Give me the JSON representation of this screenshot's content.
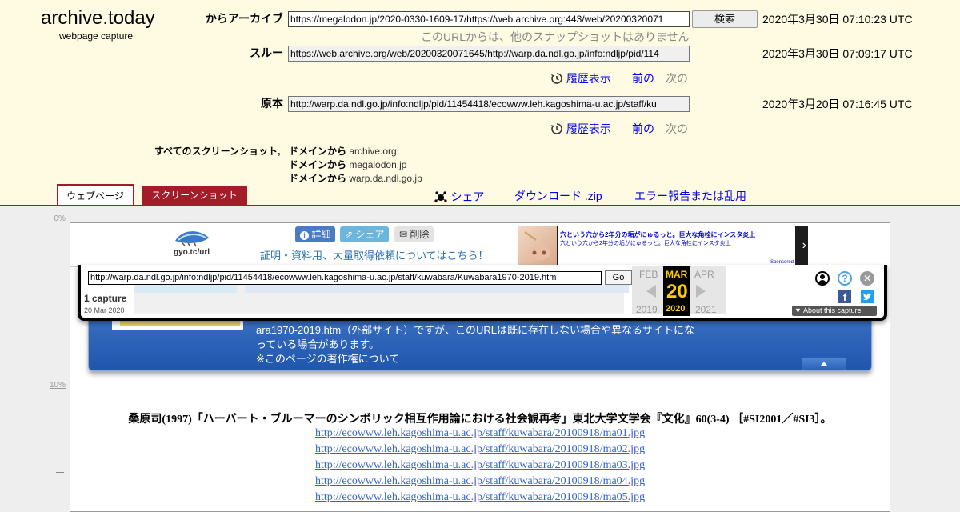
{
  "site": {
    "title": "archive.today",
    "subtitle": "webpage capture"
  },
  "rows": {
    "from": {
      "label": "からアーカイブ",
      "url": "https://megalodon.jp/2020-0330-1609-17/https://web.archive.org:443/web/20200320071",
      "timestamp": "2020年3月30日 07:10:23 UTC",
      "note": "このURLからは、他のスナップショットはありません"
    },
    "through": {
      "label": "スルー",
      "url": "https://web.archive.org/web/20200320071645/http://warp.da.ndl.go.jp/info:ndljp/pid/114",
      "timestamp": "2020年3月30日 07:09:17 UTC"
    },
    "original": {
      "label": "原本",
      "url": "http://warp.da.ndl.go.jp/info:ndljp/pid/11454418/ecowww.leh.kagoshima-u.ac.jp/staff/ku",
      "timestamp": "2020年3月20日 07:16:45 UTC"
    }
  },
  "search_button": "検索",
  "history_label": "履歴表示",
  "prev_label": "前の",
  "next_label": "次の",
  "all_screenshots_label": "すべてのスクリーンショット,",
  "from_domain_label": "ドメインから",
  "domains": [
    "archive.org",
    "megalodon.jp",
    "warp.da.ndl.go.jp"
  ],
  "tabs": {
    "webpage": "ウェブページ",
    "screenshot": "スクリーンショット"
  },
  "header_links": {
    "share": "シェア",
    "download": "ダウンロード .zip",
    "report": "エラー報告または乱用"
  },
  "ruler": {
    "top": "0%",
    "mid": "10%"
  },
  "megalodon": {
    "logo_text": "gyo.tc/url",
    "btn_detail": "詳細",
    "btn_share": "シェア",
    "btn_delete": "削除",
    "notice": "証明・資料用、大量取得依頼についてはこちら！",
    "ad_line1": "穴という穴から2年分の垢がにゅるっと。巨大な角栓にインスタ炎上",
    "ad_line2": "穴という穴から2年分の垢がにゅるっと。巨大な角栓にインスタ炎上",
    "ad_sponsored": "Sponsored"
  },
  "wayback": {
    "url": "http://warp.da.ndl.go.jp/info:ndljp/pid/11454418/ecowww.leh.kagoshima-u.ac.jp/staff/kuwabara/Kuwabara1970-2019.htm",
    "go": "Go",
    "captures": "1 capture",
    "capture_date": "20 Mar 2020",
    "prev_month": "FEB",
    "cur_month": "MAR",
    "next_month": "APR",
    "day": "20",
    "prev_year": "2019",
    "cur_year": "2020",
    "next_year": "2021",
    "about": "About this capture"
  },
  "panel": {
    "link_text": "ara1970-2019.htm",
    "text1": "（外部サイト）ですが、このURLは既に存在しない場合や異なるサイトにな",
    "text2": "っている場合があります。",
    "copyright_link": "※このページの著作権について"
  },
  "citation": "桑原司(1997)「ハーバート・ブルーマーのシンボリック相互作用論における社会観再考」東北大学文学会『文化』60(3-4) ［#SI2001／#SI3］。",
  "links": [
    "http://ecowww.leh.kagoshima-u.ac.jp/staff/kuwabara/20100918/ma01.jpg",
    "http://ecowww.leh.kagoshima-u.ac.jp/staff/kuwabara/20100918/ma02.jpg",
    "http://ecowww.leh.kagoshima-u.ac.jp/staff/kuwabara/20100918/ma03.jpg",
    "http://ecowww.leh.kagoshima-u.ac.jp/staff/kuwabara/20100918/ma04.jpg",
    "http://ecowww.leh.kagoshima-u.ac.jp/staff/kuwabara/20100918/ma05.jpg"
  ],
  "colors": {
    "header_bg": "#fffbe2",
    "accent": "#a21c2a",
    "link": "#0000ee",
    "panel_blue": "#2a5fb5",
    "wayback_yellow": "#ffcc00"
  }
}
